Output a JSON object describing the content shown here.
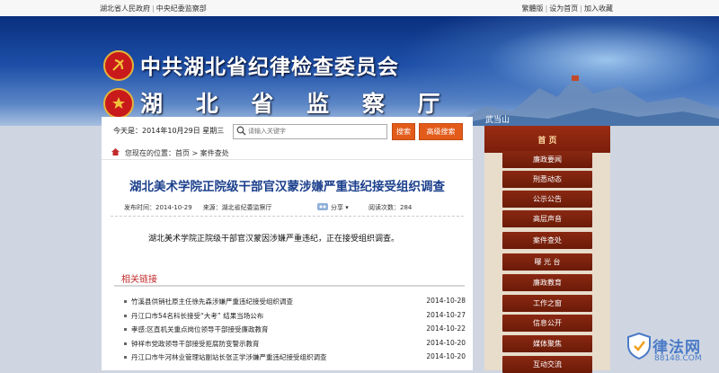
{
  "topbar": {
    "left_links": [
      "湖北省人民政府",
      "中央纪委监察部"
    ],
    "right_links": [
      "繁體版",
      "设为首页",
      "加入收藏"
    ]
  },
  "banner": {
    "title_line1": "中共湖北省纪律检查委员会",
    "title_line2": "湖 北 省 监 察 厅",
    "scene_label": "武当山",
    "colors": {
      "sky_top": "#0a2f7e",
      "emblem_red": "#c81a1a",
      "emblem_gold": "#e5b33a"
    }
  },
  "search": {
    "date_text": "今天是：2014年10月29日 星期三",
    "placeholder": "请输入关键字",
    "search_label": "搜索",
    "advanced_label": "高级搜索"
  },
  "breadcrumb": {
    "prefix": "您现在的位置：",
    "items": [
      "首页",
      "案件查处"
    ]
  },
  "article": {
    "title": "湖北美术学院正院级干部官汉蒙涉嫌严重违纪接受组织调查",
    "publish_time": "发布时间：2014-10-29",
    "source": "来源：湖北省纪委监察厅",
    "share_label": "分享",
    "visits": "阅读次数：284",
    "body": "湖北美术学院正院级干部官汉蒙因涉嫌严重违纪，正在接受组织调查。"
  },
  "related": {
    "heading": "相关链接",
    "items": [
      {
        "title": "竹溪县供销社原主任徐先森涉嫌严重违纪接受组织调查",
        "date": "2014-10-28"
      },
      {
        "title": "丹江口市54名科长接受“大考” 结果当场公布",
        "date": "2014-10-27"
      },
      {
        "title": "孝感:区直机关重点岗位领导干部接受廉政教育",
        "date": "2014-10-22"
      },
      {
        "title": "钟祥市党政领导干部接受拒腐防变警示教育",
        "date": "2014-10-20"
      },
      {
        "title": "丹江口市牛河林业管理站副站长张正学涉嫌严重违纪接受组织调查",
        "date": "2014-10-20"
      }
    ]
  },
  "nav": {
    "home": "首 页",
    "items": [
      "廉政要闻",
      "刑悉动态",
      "公示公告",
      "高层声音",
      "案件查处",
      "曝 光 台",
      "廉政教育",
      "工作之窗",
      "信息公开",
      "媒体聚焦",
      "互动交流"
    ],
    "colors": {
      "item_bg": "#7a1e0a",
      "panel_bg": "#e8dccb"
    }
  },
  "watermark": {
    "text": "律法网",
    "domain": "88148.COM"
  }
}
